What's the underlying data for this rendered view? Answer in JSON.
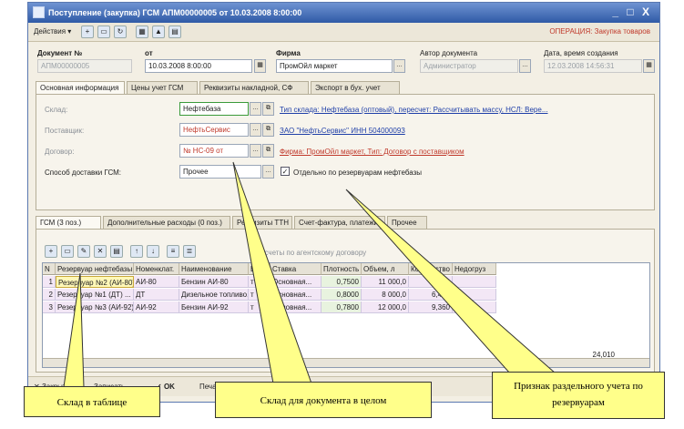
{
  "window": {
    "title": "Поступление (закупка) ГСМ АПМ00000005 от 10.03.2008 8:00:00",
    "controls": "_ □ X"
  },
  "toolbar": {
    "actions_label": "Действия ▾",
    "operation_label": "ОПЕРАЦИЯ: Закупка товаров"
  },
  "header": {
    "document_no_label": "Документ №",
    "document_no_value": "АПМ00000005",
    "date_label": "от",
    "date_value": "10.03.2008 8:00:00",
    "company_label": "Фирма",
    "company_value": "ПромОйл маркет",
    "author_label": "Автор документа",
    "author_value": "Администратор",
    "created_label": "Дата, время создания",
    "created_value": "12.03.2008 14:56:31"
  },
  "main_tabs": [
    {
      "label": "Основная информация"
    },
    {
      "label": "Цены учет ГСМ"
    },
    {
      "label": "Реквизиты накладной, СФ"
    },
    {
      "label": "Экспорт в бух. учет"
    }
  ],
  "form": {
    "warehouse_label": "Склад:",
    "warehouse_value": "Нефтебаза",
    "warehouse_info": "Тип склада: Нефтебаза (оптовый), пересчет: Рассчитывать массу, НСЛ: Вере...",
    "supplier_label": "Поставщик:",
    "supplier_value": "НефтьСервис",
    "supplier_info": "ЗАО \"НефтьСервис\" ИНН 504000093",
    "contract_label": "Договор:",
    "contract_value": "№ НС-09 от",
    "contract_info": "Фирма: ПромОйл маркет, Тип: Договор с поставщиком",
    "delivery_label": "Способ доставки ГСМ:",
    "delivery_value": "Прочее",
    "separate_checkbox_label": "Отдельно по резервуарам нефтебазы",
    "separate_checked": true
  },
  "sub_tabs": [
    {
      "label": "ГСМ (3 поз.)"
    },
    {
      "label": "Дополнительные расходы (0 поз.)"
    },
    {
      "label": "Реквизиты ТТН"
    },
    {
      "label": "Счет-фактура, платежи"
    },
    {
      "label": "Прочее"
    }
  ],
  "grid_hint": "Расчеты по агентскому договору",
  "grid": {
    "columns": [
      "N",
      "Резервуар нефтебазы",
      "Номенклат.",
      "Наименование",
      "Ед.",
      "Ставка",
      "Плотность",
      "Объем, л",
      "Количество",
      "Недогруз"
    ],
    "rows": [
      {
        "n": "1",
        "tank": "Резервуар №2 (АИ-80)...",
        "nom": "АИ-80",
        "name": "Бензин АИ-80",
        "unit": "т",
        "rate": "Основная...",
        "density": "0,7500",
        "volume": "11 000,0",
        "qty": "8,250",
        "short": ""
      },
      {
        "n": "2",
        "tank": "Резервуар №1 (ДТ) ...",
        "nom": "ДТ",
        "name": "Дизельное топливо...",
        "unit": "т",
        "rate": "Основная...",
        "density": "0,8000",
        "volume": "8 000,0",
        "qty": "6,400",
        "short": ""
      },
      {
        "n": "3",
        "tank": "Резервуар №3 (АИ-92)...",
        "nom": "АИ-92",
        "name": "Бензин АИ-92",
        "unit": "т",
        "rate": "Основная...",
        "density": "0,7800",
        "volume": "12 000,0",
        "qty": "9,360",
        "short": ""
      }
    ],
    "total_qty": "24,010"
  },
  "footer": {
    "close_label": "Закрыть",
    "print_label": "Печать",
    "ok_label": "OK",
    "write_label": "Записать"
  },
  "callouts": {
    "table_warehouse": "Склад в таблице",
    "doc_warehouse": "Склад для документа в целом",
    "tank_flag": "Признак раздельного учета по резервуарам"
  },
  "colors": {
    "title_bar": "#2f5aa6",
    "callout_fill": "#ffff8a",
    "link": "#1f3fa8",
    "operation_text": "#c0392b"
  }
}
